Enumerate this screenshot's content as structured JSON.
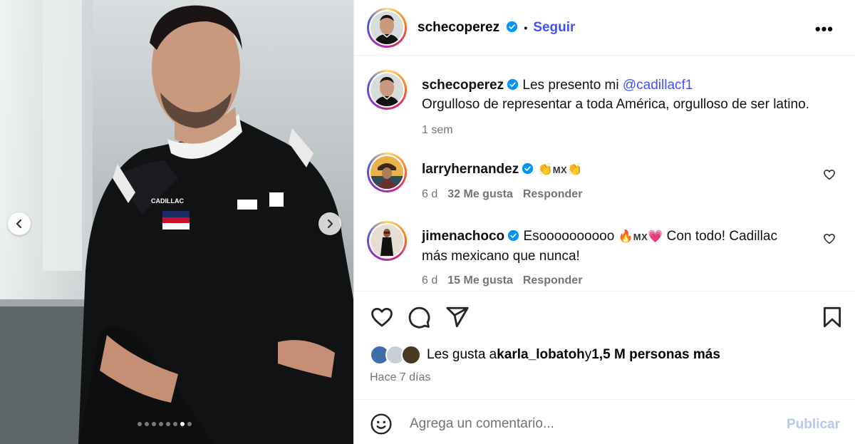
{
  "post": {
    "author": "schecoperez",
    "follow_label": "Seguir",
    "separator": "•",
    "more_label": "•••",
    "carousel": {
      "slide_count": 8,
      "active_index": 6
    }
  },
  "caption": {
    "author": "schecoperez",
    "text_before": "Les presento mi ",
    "mention": "@cadillacf1",
    "line2": "Orgulloso de representar a toda América, orgulloso de ser latino.",
    "time": "1 sem"
  },
  "comments": [
    {
      "author": "larryhernandez",
      "emoji_before": "👏",
      "flag": "MX",
      "emoji_after": "👏",
      "text": "",
      "time": "6 d",
      "likes": "32 Me gusta",
      "reply_label": "Responder"
    },
    {
      "author": "jimenachoco",
      "text_before": "Esoooooooooo ",
      "emoji_before": "🔥",
      "flag": "MX",
      "emoji_after": "💗",
      "text_after": " Con todo! Cadillac",
      "line2": "más mexicano que nunca!",
      "time": "6 d",
      "likes": "15 Me gusta",
      "reply_label": "Responder"
    }
  ],
  "likes_summary": {
    "prefix": "Les gusta a ",
    "user": "karla_lobatoh",
    "middle": " y ",
    "count": "1,5 M personas más"
  },
  "posted_time": "Hace 7 días",
  "comment_box": {
    "placeholder": "Agrega un comentario...",
    "publish_label": "Publicar"
  },
  "colors": {
    "accent": "#4150f7",
    "publish_disabled": "#b3c9f5",
    "muted": "#737373",
    "verified": "#0095f6"
  },
  "icons": [
    "verified-icon",
    "heart-icon",
    "comment-icon",
    "share-icon",
    "bookmark-icon",
    "smiley-icon",
    "chevron-left-icon",
    "chevron-right-icon"
  ]
}
